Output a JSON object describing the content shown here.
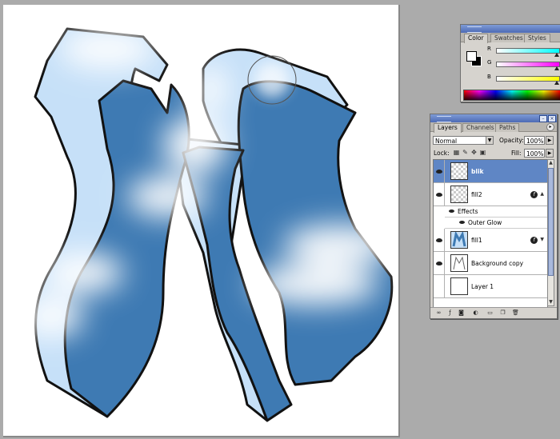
{
  "canvas": {
    "artwork_colors": {
      "dark_blue": "#3e7ab3",
      "light_blue": "#c6e0f8",
      "outline": "#111111"
    }
  },
  "color_palette": {
    "tabs": [
      {
        "label": "Color",
        "active": true
      },
      {
        "label": "Swatches",
        "active": false
      },
      {
        "label": "Styles",
        "active": false
      }
    ],
    "channels": [
      {
        "label": "R",
        "gradient": [
          "#ffffff",
          "#00ffff"
        ],
        "level": 1.0
      },
      {
        "label": "G",
        "gradient": [
          "#ffffff",
          "#ff00ff"
        ],
        "level": 1.0
      },
      {
        "label": "B",
        "gradient": [
          "#ffffff",
          "#ffff00"
        ],
        "level": 1.0
      }
    ],
    "foreground_color": "#ffffff",
    "background_color": "#000000"
  },
  "layers_palette": {
    "tabs": [
      {
        "label": "Layers",
        "active": true
      },
      {
        "label": "Channels",
        "active": false
      },
      {
        "label": "Paths",
        "active": false
      }
    ],
    "blend_mode": "Normal",
    "opacity_label": "Opacity:",
    "opacity_value": "100%",
    "lock_label": "Lock:",
    "fill_label": "Fill:",
    "fill_value": "100%",
    "layers": [
      {
        "name": "blik",
        "selected": true,
        "visible": true,
        "thumb": "transparent"
      },
      {
        "name": "fill2",
        "selected": false,
        "visible": true,
        "thumb": "transparent",
        "has_effects": true
      },
      {
        "name": "Effects",
        "type": "effects-header"
      },
      {
        "name": "Outer Glow",
        "type": "effect"
      },
      {
        "name": "fill1",
        "selected": false,
        "visible": true,
        "thumb": "letter",
        "has_effects": true
      },
      {
        "name": "Background copy",
        "selected": false,
        "visible": true,
        "thumb": "sketch"
      },
      {
        "name": "Layer 1",
        "selected": false,
        "visible": false,
        "thumb": "plain"
      }
    ],
    "selection_color": "#5f86c5"
  }
}
